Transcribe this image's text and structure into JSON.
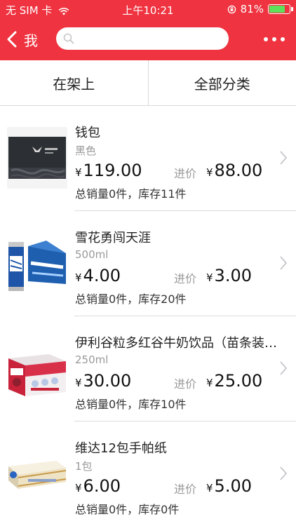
{
  "status_bar": {
    "carrier": "无 SIM 卡",
    "time": "上午10:21",
    "battery": "81%",
    "battery_level": 0.81
  },
  "nav": {
    "back_label": "我",
    "search_value": "",
    "search_placeholder": ""
  },
  "tabs": [
    {
      "label": "在架上"
    },
    {
      "label": "全部分类"
    }
  ],
  "labels": {
    "cost_label": "进价",
    "currency": "¥"
  },
  "products": [
    {
      "name": "钱包",
      "spec": "黑色",
      "price": "119.00",
      "cost": "88.00",
      "stats": "总销量0件，库存11件"
    },
    {
      "name": "雪花勇闯天涯",
      "spec": "500ml",
      "price": "4.00",
      "cost": "3.00",
      "stats": "总销量0件，库存20件"
    },
    {
      "name": "伊利谷粒多红谷牛奶饮品（苗条装…",
      "spec": "250ml",
      "price": "30.00",
      "cost": "25.00",
      "stats": "总销量0件，库存10件"
    },
    {
      "name": "维达12包手帕纸",
      "spec": "1包",
      "price": "6.00",
      "cost": "5.00",
      "stats": "总销量0件，库存0件"
    }
  ],
  "colors": {
    "brand_red": "#ef3340",
    "battery_green": "#5ee05a"
  }
}
